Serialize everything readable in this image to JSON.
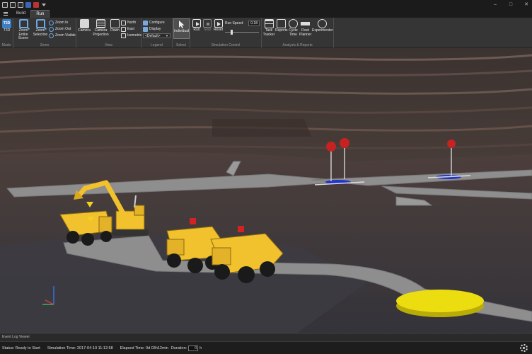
{
  "window": {
    "quick_access_icons": [
      "app-icon",
      "new-file-icon",
      "open-folder-icon",
      "save-icon",
      "workspace-icon",
      "customize-caret-icon"
    ],
    "controls": [
      "minimize-icon",
      "maximize-icon",
      "close-icon"
    ]
  },
  "tabs": [
    {
      "label": "Build",
      "active": false
    },
    {
      "label": "Run",
      "active": true
    }
  ],
  "ribbon": {
    "mode": {
      "tsd_label": "T3D",
      "group_label": "Mode"
    },
    "zoom": {
      "entire_scene": "Zoom Entire Scene",
      "selection": "Zoom Selection",
      "zoom_in": "Zoom In",
      "zoom_out": "Zoom Out",
      "zoom_visible": "Zoom Visible",
      "group_label": "Zoom"
    },
    "view": {
      "camera": "Camera",
      "camera_projection": "Camera Projection",
      "down": "Down",
      "north": "North",
      "east": "East",
      "isometric": "Isometric",
      "group_label": "View"
    },
    "legend": {
      "configure": "Configure",
      "display": "Display",
      "dropdown_value": "<Default>",
      "group_label": "Legend"
    },
    "select": {
      "individual": "Individual",
      "group_label": "Select"
    },
    "simulation": {
      "run": "Run",
      "stop": "Stop",
      "reset": "Reset",
      "speed_label": "Run Speed:",
      "speed_value": "0.18",
      "speed_fraction": 0.18,
      "group_label": "Simulation Control"
    },
    "analysis": {
      "task_tracker": "Task Tracker",
      "reports": "Reports",
      "cycle_time": "Cycle Time",
      "fleet_planner": "Fleet Planner",
      "experimenter": "Experimenter",
      "group_label": "Analysis & Reports"
    }
  },
  "event_log": {
    "label": "Event Log Viewer"
  },
  "status": {
    "status": "Status: Ready to Start",
    "sim_time": "Simulation Time: 2017-04-10 11:12:58",
    "elapsed": "Elapsed Time: 0d 03h12min",
    "duration_label": "Duration:",
    "duration_value": "0",
    "duration_unit": "h"
  },
  "colors": {
    "truck": "#f2c12e",
    "marker_red": "#c62222",
    "marker_blue": "#2233cc",
    "dump_pad": "#ecdd10",
    "road": "#8e8e8e"
  }
}
